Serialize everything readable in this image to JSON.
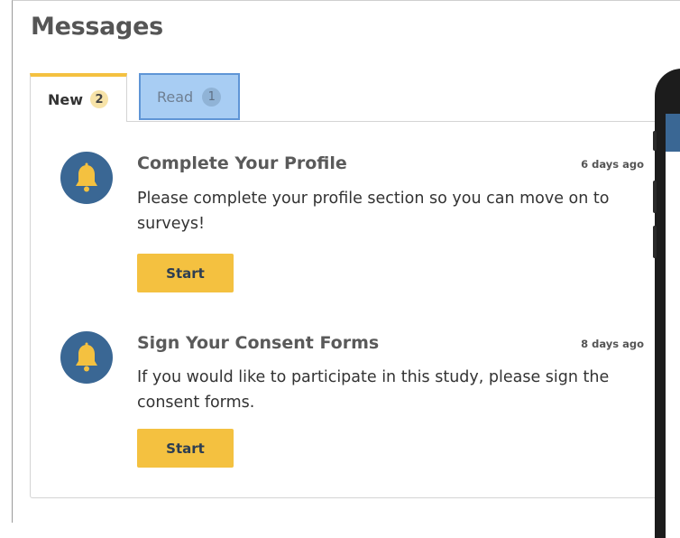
{
  "page": {
    "title": "Messages"
  },
  "tabs": {
    "new": {
      "label": "New",
      "count": "2"
    },
    "read": {
      "label": "Read",
      "count": "1"
    }
  },
  "messages": [
    {
      "icon": "bell-icon",
      "title": "Complete Your Profile",
      "time": "6 days ago",
      "body": "Please complete your profile section so you can move on to surveys!",
      "button": "Start"
    },
    {
      "icon": "bell-icon",
      "title": "Sign Your Consent Forms",
      "time": "8 days ago",
      "body": "If you would like to participate in this study, please sign the consent forms.",
      "button": "Start"
    }
  ],
  "colors": {
    "accent": "#f4c140",
    "icon_bg": "#3a6794",
    "read_tab_highlight": "#a8cdf3"
  }
}
